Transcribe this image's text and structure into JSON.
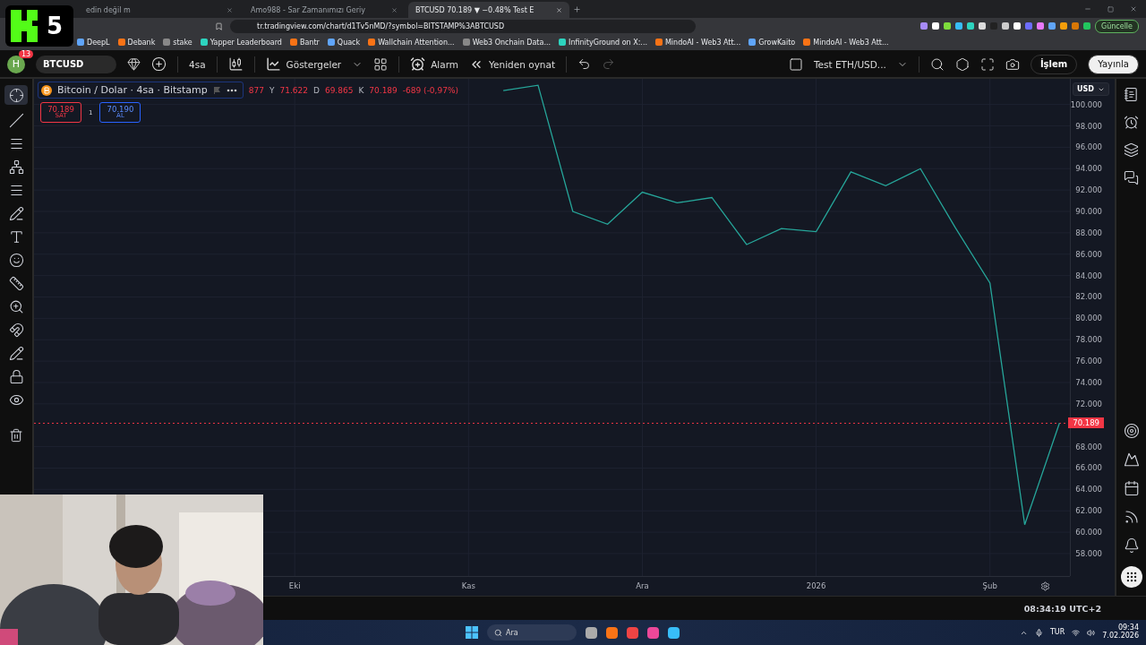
{
  "overlay_logo": {
    "number": "5"
  },
  "browser": {
    "tabs": [
      {
        "title": "edin değil m",
        "selected": false
      },
      {
        "title": "Amo988 - Sar Zamanımızı Geriy",
        "selected": false
      },
      {
        "title": "BTCUSD 70.189 ▼ −0.48% Test E",
        "selected": true
      }
    ],
    "address": "tr.tradingview.com/chart/d1Tv5nMD/?symbol=BITSTAMP%3ABTCUSD",
    "update_button": "Güncelle",
    "bookmarks": [
      "DeepL",
      "Debank",
      "stake",
      "Yapper Leaderboard",
      "Bantr",
      "Quack",
      "Wallchain Attention...",
      "Web3 Onchain Data...",
      "InfinityGround on X:...",
      "MindoAI - Web3 Att...",
      "GrowKaito",
      "MindoAI - Web3 Att..."
    ]
  },
  "toolbar": {
    "avatar": "H",
    "notifications": "13",
    "symbol": "BTCUSD",
    "interval": "4sa",
    "indicators": "Göstergeler",
    "alarm": "Alarm",
    "replay": "Yeniden oynat",
    "layout_name": "Test ETH/USD...",
    "trade_button": "İşlem",
    "publish_button": "Yayınla"
  },
  "legend": {
    "title": "Bitcoin / Dolar · 4sa · Bitstamp",
    "values": [
      {
        "value": "877"
      },
      {
        "label": "Y",
        "value": "71.622"
      },
      {
        "label": "D",
        "value": "69.865"
      },
      {
        "label": "K",
        "value": "70.189"
      }
    ],
    "change": "-689 (-0,97%)"
  },
  "order_panel": {
    "sell_price": "70.189",
    "sell_label": "SAT",
    "quantity": "1",
    "buy_price": "70.190",
    "buy_label": "AL"
  },
  "price_axis": {
    "currency": "USD",
    "current_price": "70.189"
  },
  "chart_data": {
    "type": "line",
    "categories": [
      null,
      null,
      null,
      null,
      null,
      null,
      null,
      "Eki",
      null,
      null,
      null,
      null,
      "Kas",
      null,
      null,
      null,
      null,
      "Ara",
      null,
      null,
      null,
      null,
      "2026",
      null,
      null,
      null,
      null,
      "Şub",
      null,
      null
    ],
    "series": [
      {
        "color": "#26a69a",
        "values": [
          null,
          null,
          null,
          null,
          null,
          null,
          null,
          null,
          null,
          null,
          null,
          null,
          null,
          101.3,
          101.8,
          90.0,
          88.8,
          91.8,
          90.8,
          91.3,
          86.9,
          88.4,
          88.1,
          93.7,
          92.4,
          94.0,
          88.5,
          83.3,
          60.7,
          70.2
        ]
      }
    ],
    "ylim": [
      55.9,
      102.4
    ],
    "grid": true,
    "ref_lines": [
      {
        "axis": "y",
        "value": 70.189,
        "color": "#f23645"
      }
    ],
    "yticks": [
      {
        "value": 58,
        "label": "58.000"
      },
      {
        "value": 60,
        "label": "60.000"
      },
      {
        "value": 62,
        "label": "62.000"
      },
      {
        "value": 64,
        "label": "64.000"
      },
      {
        "value": 66,
        "label": "66.000"
      },
      {
        "value": 68,
        "label": "68.000"
      },
      {
        "value": 72,
        "label": "72.000"
      },
      {
        "value": 74,
        "label": "74.000"
      },
      {
        "value": 76,
        "label": "76.000"
      },
      {
        "value": 78,
        "label": "78.000"
      },
      {
        "value": 80,
        "label": "80.000"
      },
      {
        "value": 82,
        "label": "82.000"
      },
      {
        "value": 84,
        "label": "84.000"
      },
      {
        "value": 86,
        "label": "86.000"
      },
      {
        "value": 88,
        "label": "88.000"
      },
      {
        "value": 90,
        "label": "90.000"
      },
      {
        "value": 92,
        "label": "92.000"
      },
      {
        "value": 94,
        "label": "94.000"
      },
      {
        "value": 96,
        "label": "96.000"
      },
      {
        "value": 98,
        "label": "98.000"
      },
      {
        "value": 100,
        "label": "100.000"
      }
    ]
  },
  "status_bar": {
    "clock": "08:34:19 UTC+2"
  },
  "taskbar": {
    "search": "Ara",
    "language": "TUR",
    "time": "09:34",
    "date": "7.02.2026"
  }
}
